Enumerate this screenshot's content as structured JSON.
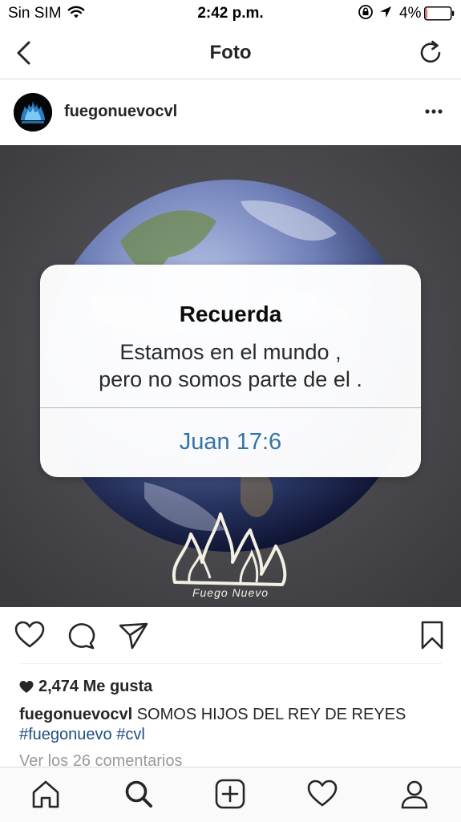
{
  "status_bar": {
    "carrier": "Sin SIM",
    "time": "2:42 p.m.",
    "battery_percent": "4%",
    "battery_level": 0.04,
    "battery_color": "#ff3b30"
  },
  "nav": {
    "title": "Foto",
    "back_icon": "chevron-left-icon",
    "refresh_icon": "refresh-icon"
  },
  "post": {
    "username": "fuegonuevocvl",
    "more_icon": "ellipsis-icon",
    "image": {
      "dialog_title": "Recuerda",
      "dialog_message_line1": "Estamos en el mundo ,",
      "dialog_message_line2": "pero no somos parte de el .",
      "dialog_button": "Juan 17:6",
      "brand_text": "Fuego Nuevo"
    },
    "likes": "2,474 Me gusta",
    "caption_user": "fuegonuevocvl",
    "caption_text": "SOMOS HIJOS DEL REY DE REYES",
    "hashtags": "#fuegonuevo #cvl",
    "view_comments": "Ver los 26 comentarios"
  },
  "tabs": [
    {
      "name": "home",
      "icon": "home-icon"
    },
    {
      "name": "search",
      "icon": "search-icon"
    },
    {
      "name": "new-post",
      "icon": "add-post-icon"
    },
    {
      "name": "activity",
      "icon": "heart-icon"
    },
    {
      "name": "profile",
      "icon": "profile-icon"
    }
  ],
  "colors": {
    "link_blue": "#1f4d80",
    "dialog_button_blue": "#3473a5",
    "text_dark": "#262626",
    "muted": "#999999"
  }
}
